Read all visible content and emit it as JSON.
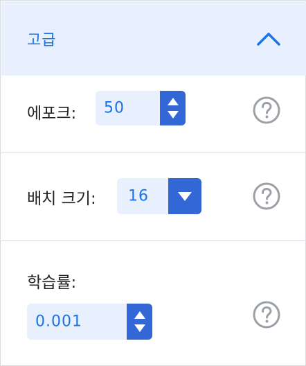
{
  "header": {
    "title": "고급",
    "toggle_icon": "chevron-up-icon"
  },
  "rows": {
    "epochs": {
      "label": "에포크:",
      "value": "50",
      "help_icon": "help-circle-icon"
    },
    "batch_size": {
      "label": "배치 크기:",
      "value": "16",
      "help_icon": "help-circle-icon"
    },
    "learning_rate": {
      "label": "학습률:",
      "value": "0.001",
      "help_icon": "help-circle-icon"
    }
  },
  "colors": {
    "accent": "#1a73e8",
    "control": "#3367d6",
    "field_bg": "#e8f0fe",
    "help_icon": "#9aa0a6"
  }
}
